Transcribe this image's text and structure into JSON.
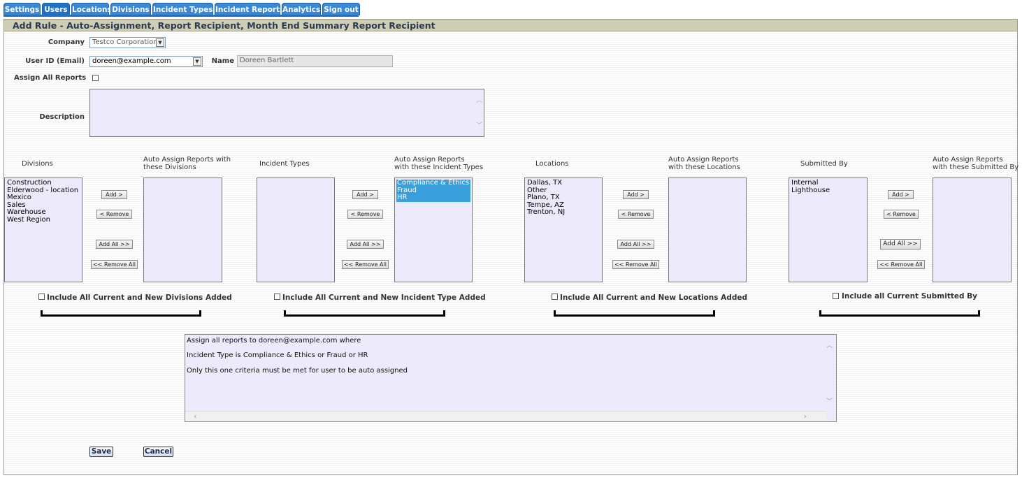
{
  "tabs": [
    {
      "label": "Settings"
    },
    {
      "label": "Users"
    },
    {
      "label": "Locations"
    },
    {
      "label": "Divisions"
    },
    {
      "label": "Incident Types"
    },
    {
      "label": "Incident Reports"
    },
    {
      "label": "Analytics"
    },
    {
      "label": "Sign out"
    }
  ],
  "active_tab": "Users",
  "panel": {
    "title": "Add Rule - Auto-Assignment, Report Recipient, Month End Summary Report Recipient"
  },
  "form": {
    "company_label": "Company",
    "company_value": "Testco Corporation",
    "user_label": "User ID (Email)",
    "user_value": "doreen@example.com",
    "name_label": "Name",
    "name_value": "Doreen Bartlett",
    "assign_all_label": "Assign All Reports",
    "description_label": "Description",
    "description_value": ""
  },
  "groups": {
    "divisions": {
      "available_label": "Divisions",
      "assigned_label_1": "Auto Assign Reports with",
      "assigned_label_2": "these Divisions",
      "available": [
        "Construction",
        "Elderwood - location",
        "Mexico",
        "Sales",
        "Warehouse",
        "West Region"
      ],
      "assigned": [],
      "include_label": "Include All Current and New Divisions Added"
    },
    "incident_types": {
      "available_label": "Incident Types",
      "assigned_label_1": "Auto Assign Reports",
      "assigned_label_2": "with these Incident Types",
      "available": [],
      "assigned": [
        "Compliance & Ethics",
        "Fraud",
        "HR"
      ],
      "include_label": "Include All Current and New Incident Type Added"
    },
    "locations": {
      "available_label": "Locations",
      "assigned_label_1": "Auto Assign Reports",
      "assigned_label_2": "with these Locations",
      "available": [
        "Dallas, TX",
        "Other",
        "Plano, TX",
        "Tempe, AZ",
        "Trenton, NJ"
      ],
      "assigned": [],
      "include_label": "Include All Current and New Locations Added"
    },
    "submitted_by": {
      "available_label": "Submitted By",
      "assigned_label_1": "Auto Assign Reports",
      "assigned_label_2": "with these Submitted By",
      "available": [
        "Internal",
        "Lighthouse"
      ],
      "assigned": [],
      "include_label": "Include all Current Submitted By"
    }
  },
  "buttons": {
    "add": "Add >",
    "remove": "< Remove",
    "add_all": "Add All >>",
    "remove_all": "<< Remove All",
    "save": "Save",
    "cancel": "Cancel"
  },
  "summary": {
    "line1": "Assign all reports to doreen@example.com where",
    "line2": "Incident Type is Compliance & Ethics or Fraud or HR",
    "line3": "Only this one criteria must be met for user to be auto assigned"
  },
  "colors": {
    "tab_bg": "#3a88d4",
    "tab_active": "#1f6fc5",
    "header_bg": "#cfcdb3",
    "list_bg": "#eceafb",
    "selected_option": "#3aa0dc"
  }
}
